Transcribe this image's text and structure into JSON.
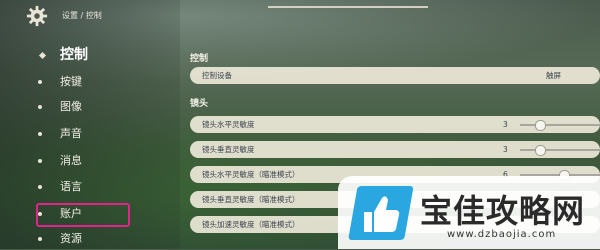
{
  "header": {
    "breadcrumb": "设置 / 控制"
  },
  "sidebar": {
    "items": [
      {
        "label": "控制",
        "active": true
      },
      {
        "label": "按键"
      },
      {
        "label": "图像"
      },
      {
        "label": "声音"
      },
      {
        "label": "消息"
      },
      {
        "label": "语言"
      },
      {
        "label": "账户"
      },
      {
        "label": "资源"
      }
    ]
  },
  "main": {
    "section_control": "控制",
    "control_device": {
      "label": "控制设备",
      "value": "触屏"
    },
    "section_camera": "镜头",
    "rows": [
      {
        "label": "镜头水平灵敏度",
        "value": "3",
        "level": 0.25
      },
      {
        "label": "镜头垂直灵敏度",
        "value": "3",
        "level": 0.25
      },
      {
        "label": "镜头水平灵敏度（瞄准模式）",
        "value": "6",
        "level": 0.55
      },
      {
        "label": "镜头垂直灵敏度（瞄准模式）",
        "value": "",
        "level": 0.55
      },
      {
        "label": "镜头加速灵敏度（瞄准模式）",
        "value": "",
        "level": 0.55
      }
    ]
  },
  "watermark": {
    "title": "宝佳攻略网",
    "url": "www.dzbaojia.com"
  },
  "colors": {
    "highlight": "#e2238c",
    "row_bg": "#ece7d7",
    "logo_blue": "#2aa7e0"
  },
  "icons": {
    "settings": "gear-icon",
    "logo": "thumbs-up-icon"
  }
}
